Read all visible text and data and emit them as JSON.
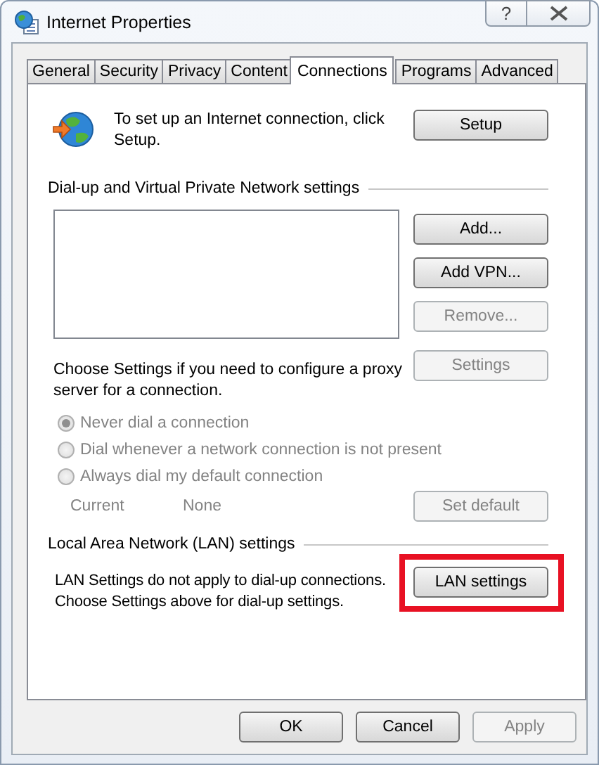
{
  "window": {
    "title": "Internet Properties",
    "help_label": "?"
  },
  "tabs": [
    {
      "label": "General",
      "selected": false
    },
    {
      "label": "Security",
      "selected": false
    },
    {
      "label": "Privacy",
      "selected": false
    },
    {
      "label": "Content",
      "selected": false
    },
    {
      "label": "Connections",
      "selected": true
    },
    {
      "label": "Programs",
      "selected": false
    },
    {
      "label": "Advanced",
      "selected": false
    }
  ],
  "setup": {
    "lines": [
      "To set up an Internet connection, click",
      "Setup."
    ],
    "button": {
      "label": "Setup",
      "disabled": false
    }
  },
  "dialup": {
    "heading": "Dial-up and Virtual Private Network settings",
    "buttons": [
      {
        "label": "Add...",
        "disabled": false
      },
      {
        "label": "Add VPN...",
        "disabled": false
      },
      {
        "label": "Remove...",
        "disabled": true
      }
    ],
    "proxy_lines": [
      "Choose Settings if you need to configure a proxy",
      "server for a connection."
    ],
    "settings_button": {
      "label": "Settings",
      "disabled": true
    },
    "radios": [
      {
        "label": "Never dial a connection",
        "selected": true,
        "disabled": true
      },
      {
        "label": "Dial whenever a network connection is not present",
        "selected": false,
        "disabled": true
      },
      {
        "label": "Always dial my default connection",
        "selected": false,
        "disabled": true
      }
    ],
    "current_label": "Current",
    "current_value": "None",
    "set_default_button": {
      "label": "Set default",
      "disabled": true
    }
  },
  "lan": {
    "heading": "Local Area Network (LAN) settings",
    "lines": [
      "LAN Settings do not apply to dial-up connections.",
      "Choose Settings above for dial-up settings."
    ],
    "button": {
      "label": "LAN settings",
      "disabled": false,
      "highlighted": true
    }
  },
  "footer_buttons": [
    {
      "label": "OK",
      "disabled": false
    },
    {
      "label": "Cancel",
      "disabled": false
    },
    {
      "label": "Apply",
      "disabled": true
    }
  ]
}
